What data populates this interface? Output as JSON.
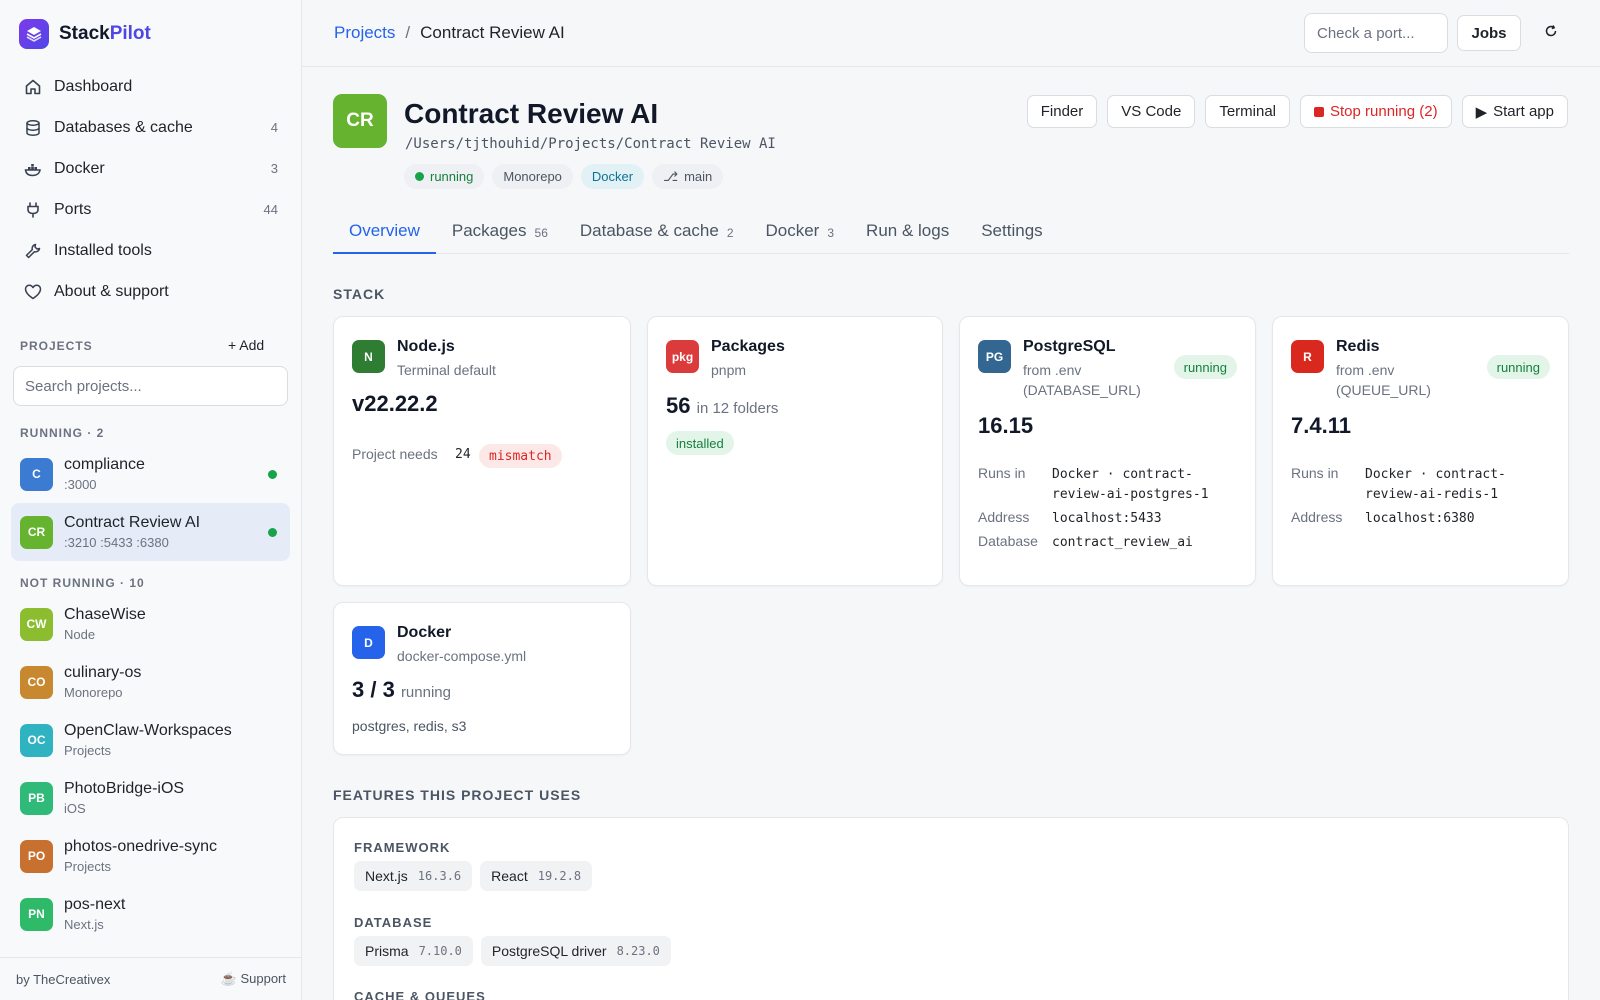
{
  "brand": {
    "name_a": "Stack",
    "name_b": "Pilot"
  },
  "nav": [
    {
      "label": "Dashboard",
      "count": ""
    },
    {
      "label": "Databases & cache",
      "count": "4"
    },
    {
      "label": "Docker",
      "count": "3"
    },
    {
      "label": "Ports",
      "count": "44"
    },
    {
      "label": "Installed tools",
      "count": ""
    },
    {
      "label": "About & support",
      "count": ""
    }
  ],
  "projects_section": {
    "title": "PROJECTS",
    "add_label": "+ Add",
    "search_placeholder": "Search projects..."
  },
  "running_head": "RUNNING · 2",
  "not_running_head": "NOT RUNNING · 10",
  "projects": [
    {
      "initials": "C",
      "name": "compliance",
      "sub": ":3000",
      "color": "#3b7bd1"
    },
    {
      "initials": "CR",
      "name": "Contract Review AI",
      "sub": ":3210 :5433 :6380",
      "color": "#65b32e"
    },
    {
      "initials": "CW",
      "name": "ChaseWise",
      "sub": "Node",
      "color": "#8bbd2f"
    },
    {
      "initials": "CO",
      "name": "culinary-os",
      "sub": "Monorepo",
      "color": "#c8882f"
    },
    {
      "initials": "OC",
      "name": "OpenClaw-Workspaces",
      "sub": "Projects",
      "color": "#2fb3c0"
    },
    {
      "initials": "PB",
      "name": "PhotoBridge-iOS",
      "sub": "iOS",
      "color": "#2fba7a"
    },
    {
      "initials": "PO",
      "name": "photos-onedrive-sync",
      "sub": "Projects",
      "color": "#c8702f"
    },
    {
      "initials": "PN",
      "name": "pos-next",
      "sub": "Next.js",
      "color": "#2fba6a"
    }
  ],
  "footer": {
    "left": "by TheCreativex",
    "right": "Support"
  },
  "topbar": {
    "crumb_root": "Projects",
    "crumb_sep": "/",
    "crumb_current": "Contract Review AI",
    "port_placeholder": "Check a port...",
    "jobs": "Jobs"
  },
  "header": {
    "initials": "CR",
    "title": "Contract Review AI",
    "path": "/Users/tjthouhid/Projects/Contract Review AI",
    "tags": {
      "status": "running",
      "kind": "Monorepo",
      "docker": "Docker",
      "branch": "main"
    },
    "actions": {
      "finder": "Finder",
      "vscode": "VS Code",
      "terminal": "Terminal",
      "stop": "Stop running (2)",
      "start": "Start app"
    }
  },
  "tabs": [
    {
      "label": "Overview",
      "count": ""
    },
    {
      "label": "Packages",
      "count": "56"
    },
    {
      "label": "Database & cache",
      "count": "2"
    },
    {
      "label": "Docker",
      "count": "3"
    },
    {
      "label": "Run & logs",
      "count": ""
    },
    {
      "label": "Settings",
      "count": ""
    }
  ],
  "stack_title": "STACK",
  "cards": {
    "node": {
      "icon": "N",
      "name": "Node.js",
      "sub": "Terminal default",
      "version": "v22.22.2",
      "needs_label": "Project needs",
      "needs_value": "24",
      "badge": "mismatch",
      "color": "#2e7d32"
    },
    "packages": {
      "icon": "pkg",
      "name": "Packages",
      "sub": "pnpm",
      "count": "56",
      "count_sub": "in 12 folders",
      "badge": "installed",
      "color": "#dc3b3b"
    },
    "postgres": {
      "icon": "PG",
      "name": "PostgreSQL",
      "sub": "from .env (DATABASE_URL)",
      "badge": "running",
      "version": "16.15",
      "runs_in_label": "Runs in",
      "runs_in": "Docker · contract-review-ai-postgres-1",
      "address_label": "Address",
      "address": "localhost:5433",
      "db_label": "Database",
      "db": "contract_review_ai",
      "color": "#336791"
    },
    "redis": {
      "icon": "R",
      "name": "Redis",
      "sub": "from .env (QUEUE_URL)",
      "badge": "running",
      "version": "7.4.11",
      "runs_in_label": "Runs in",
      "runs_in": "Docker · contract-review-ai-redis-1",
      "address_label": "Address",
      "address": "localhost:6380",
      "color": "#d9281e"
    },
    "docker": {
      "icon": "D",
      "name": "Docker",
      "sub": "docker-compose.yml",
      "count": "3 / 3",
      "count_sub": "running",
      "services": "postgres, redis, s3",
      "color": "#2563eb"
    }
  },
  "features_title": "FEATURES THIS PROJECT USES",
  "features": {
    "framework": {
      "label": "FRAMEWORK",
      "items": [
        {
          "name": "Next.js",
          "ver": "16.3.6"
        },
        {
          "name": "React",
          "ver": "19.2.8"
        }
      ]
    },
    "database": {
      "label": "DATABASE",
      "items": [
        {
          "name": "Prisma",
          "ver": "7.10.0"
        },
        {
          "name": "PostgreSQL driver",
          "ver": "8.23.0"
        }
      ]
    },
    "cache": {
      "label": "CACHE & QUEUES"
    }
  }
}
